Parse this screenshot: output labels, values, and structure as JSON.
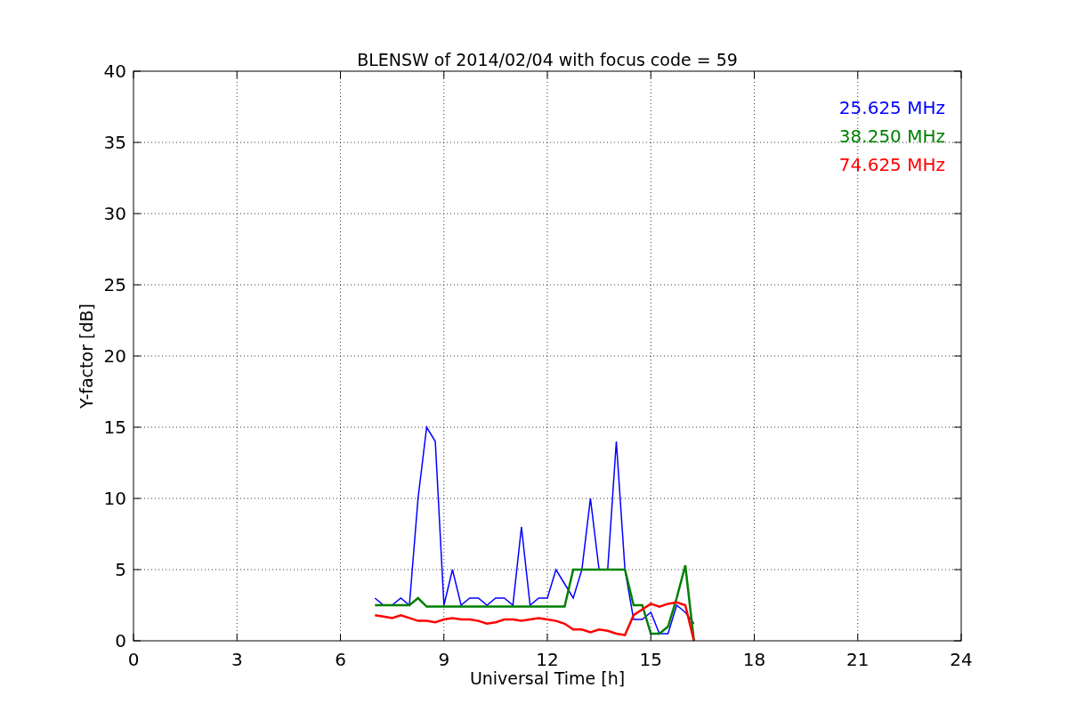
{
  "chart": {
    "chart_data": {
      "type": "line",
      "title": "BLENSW of 2014/02/04 with focus code = 59",
      "xlabel": "Universal Time [h]",
      "ylabel": "Y-factor [dB]",
      "x": [
        7.0,
        7.25,
        7.5,
        7.75,
        8.0,
        8.25,
        8.5,
        8.75,
        9.0,
        9.25,
        9.5,
        9.75,
        10.0,
        10.25,
        10.5,
        10.75,
        11.0,
        11.25,
        11.5,
        11.75,
        12.0,
        12.25,
        12.5,
        12.75,
        13.0,
        13.25,
        13.5,
        13.75,
        14.0,
        14.25,
        14.5,
        14.75,
        15.0,
        15.25,
        15.5,
        15.75,
        16.0,
        16.25
      ],
      "series": [
        {
          "name": "25.625 MHz",
          "color": "#0000ff",
          "values": [
            3,
            2.5,
            2.5,
            3,
            2.5,
            10,
            15,
            14,
            2.5,
            5,
            2.5,
            3,
            3,
            2.5,
            3,
            3,
            2.5,
            8,
            2.5,
            3,
            3,
            5,
            4,
            3,
            5,
            10,
            5,
            5,
            14,
            5,
            1.5,
            1.5,
            2,
            0.5,
            0.5,
            2.5,
            2,
            1.2
          ]
        },
        {
          "name": "38.250 MHz",
          "color": "#008000",
          "values": [
            2.5,
            2.5,
            2.5,
            2.5,
            2.5,
            3,
            2.4,
            2.4,
            2.4,
            2.4,
            2.4,
            2.4,
            2.4,
            2.4,
            2.4,
            2.4,
            2.4,
            2.4,
            2.4,
            2.4,
            2.4,
            2.4,
            2.4,
            5,
            5,
            5,
            5,
            5,
            5,
            5,
            2.5,
            2.5,
            0.5,
            0.5,
            1,
            3,
            5.3,
            0
          ]
        },
        {
          "name": "74.625 MHz",
          "color": "#ff0000",
          "values": [
            1.8,
            1.7,
            1.6,
            1.8,
            1.6,
            1.4,
            1.4,
            1.3,
            1.5,
            1.6,
            1.5,
            1.5,
            1.4,
            1.2,
            1.3,
            1.5,
            1.5,
            1.4,
            1.5,
            1.6,
            1.5,
            1.4,
            1.2,
            0.8,
            0.8,
            0.6,
            0.8,
            0.7,
            0.5,
            0.4,
            1.8,
            2.2,
            2.6,
            2.4,
            2.6,
            2.7,
            2.5,
            0
          ]
        }
      ],
      "grid": true,
      "xlim": [
        0,
        24
      ],
      "ylim": [
        0,
        40
      ],
      "xticks": [
        0,
        3,
        6,
        9,
        12,
        15,
        18,
        21,
        24
      ],
      "yticks": [
        0,
        5,
        10,
        15,
        20,
        25,
        30,
        35,
        40
      ]
    }
  }
}
